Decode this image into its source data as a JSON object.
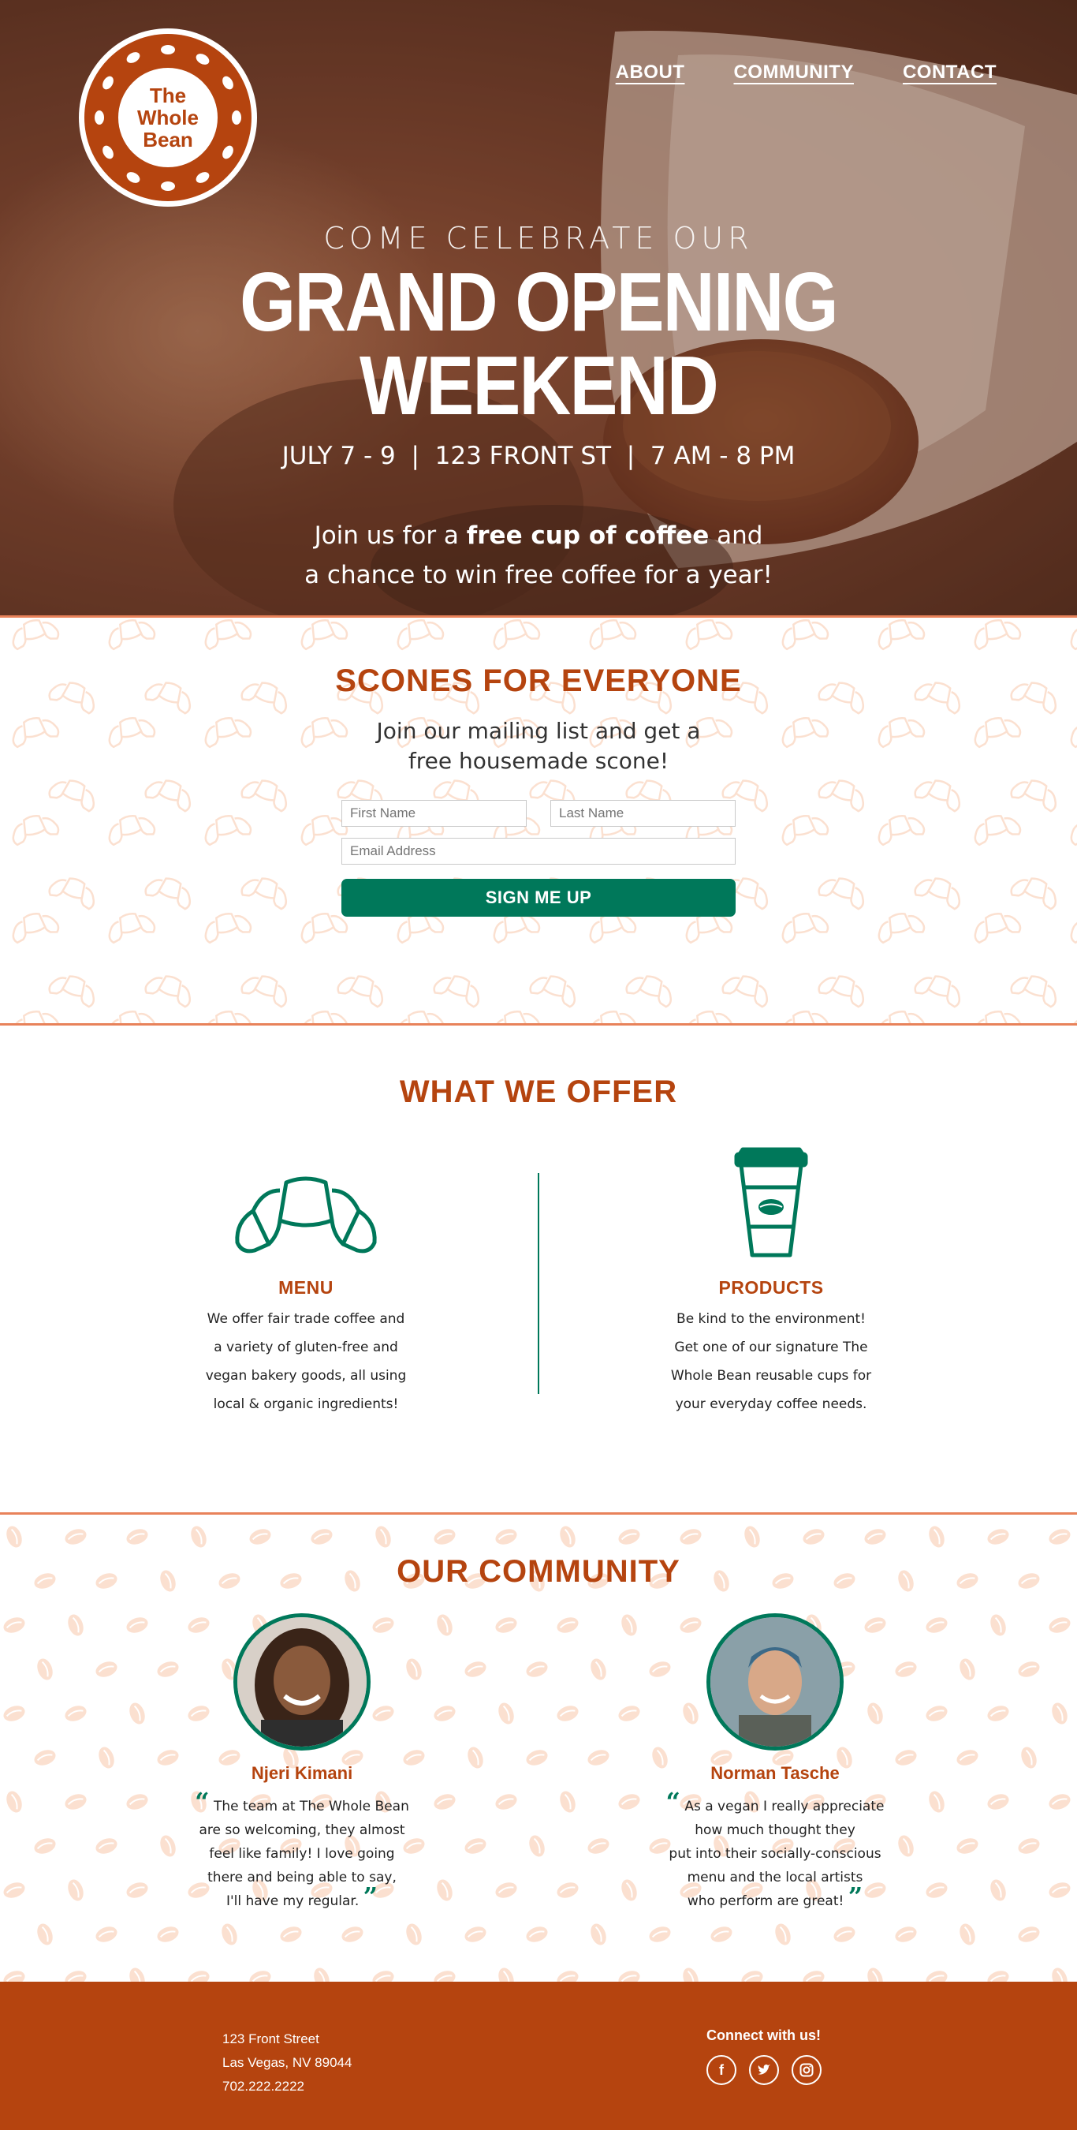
{
  "brand": {
    "logo_line1": "The",
    "logo_line2": "Whole",
    "logo_line3": "Bean"
  },
  "nav": {
    "items": [
      "ABOUT",
      "COMMUNITY",
      "CONTACT"
    ]
  },
  "hero": {
    "eyebrow": "COME CELEBRATE  OUR",
    "headline": "GRAND OPENING WEEKEND",
    "dates": "JULY 7 - 9",
    "address": "123 FRONT ST",
    "hours": "7 AM - 8 PM",
    "separator": "|",
    "invite_part1": "Join us for a ",
    "invite_bold": "free cup of coffee",
    "invite_part2": " and",
    "invite_line2": "a chance to win free coffee for a year!"
  },
  "scones": {
    "title": "SCONES FOR EVERYONE",
    "sub_line1": "Join our mailing list and get a",
    "sub_line2": "free housemade scone!",
    "first_name_placeholder": "First Name",
    "last_name_placeholder": "Last Name",
    "email_placeholder": "Email Address",
    "button": "SIGN ME UP"
  },
  "offer": {
    "title": "WHAT WE OFFER",
    "menu_title": "MENU",
    "menu_lines": [
      "We offer fair trade coffee and",
      "a variety of gluten-free and",
      "vegan bakery goods, all using",
      "local & organic ingredients!"
    ],
    "products_title": "PRODUCTS",
    "products_lines": [
      "Be kind to the environment!",
      "Get one of our signature The",
      "Whole Bean reusable cups for",
      "your everyday coffee needs."
    ]
  },
  "community": {
    "title": "OUR COMMUNITY",
    "people": [
      {
        "name": "Njeri Kimani",
        "quote_lines": [
          "The team at The Whole Bean",
          "are so welcoming, they almost",
          "feel like family! I love going",
          "there and being able to say,",
          "I'll have my regular."
        ]
      },
      {
        "name": "Norman Tasche",
        "quote_lines": [
          "As a vegan I really appreciate",
          "how much thought they",
          "put into their socially-conscious",
          "menu and the local artists",
          "who perform are great!"
        ]
      }
    ]
  },
  "footer": {
    "address_line1": "123 Front Street",
    "address_line2": "Las Vegas, NV 89044",
    "phone": "702.222.2222",
    "connect_label": "Connect with us!",
    "social_icons": [
      "facebook-icon",
      "twitter-icon",
      "instagram-icon"
    ]
  },
  "colors": {
    "brand": "#b5440f",
    "accent_green": "#00785a",
    "border": "#e8825a",
    "pattern": "#fbe0d0"
  }
}
